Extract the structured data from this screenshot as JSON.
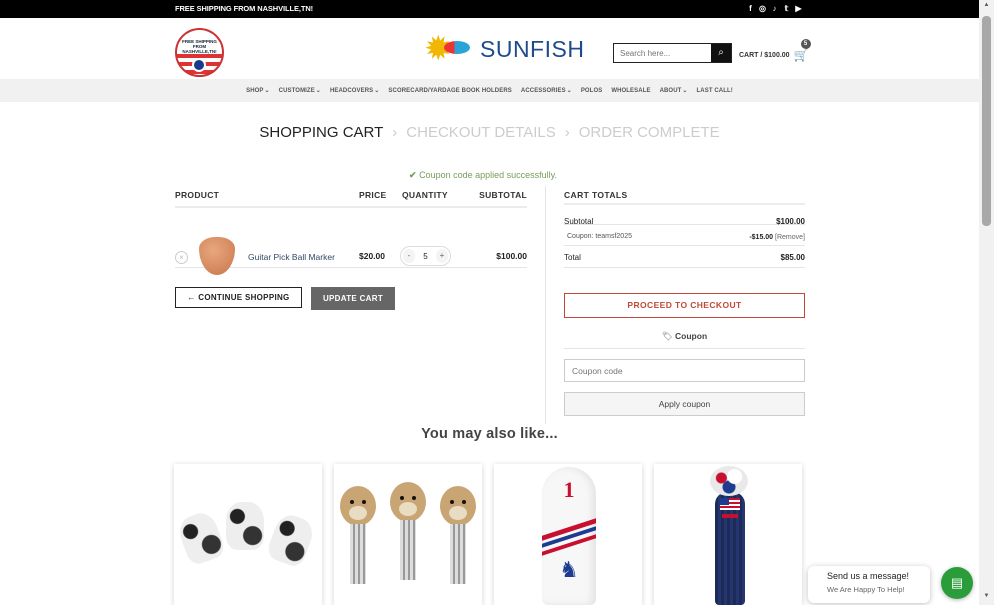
{
  "topbar": {
    "shipping": "FREE SHIPPING FROM NASHVILLE,TN!",
    "social": [
      "f",
      "◎",
      "♪",
      "𝕥",
      "▶"
    ]
  },
  "header": {
    "badge_text": "FREE SHIPPING FROM NASHVILLE,TN!",
    "logo_text": "SUNFISH",
    "search_placeholder": "Search here...",
    "cart_label": "CART / $100.00",
    "cart_count": "5"
  },
  "nav": [
    "SHOP",
    "CUSTOMIZE",
    "HEADCOVERS",
    "SCORECARD/YARDAGE BOOK HOLDERS",
    "ACCESSORIES",
    "POLOS",
    "WHOLESALE",
    "ABOUT",
    "LAST CALL!"
  ],
  "nav_dropdown": [
    true,
    true,
    true,
    false,
    true,
    false,
    false,
    true,
    false
  ],
  "steps": {
    "cart": "SHOPPING CART",
    "checkout": "CHECKOUT DETAILS",
    "complete": "ORDER COMPLETE",
    "sep": "›"
  },
  "coupon_message": "Coupon code applied successfully.",
  "cart_table": {
    "headers": {
      "product": "PRODUCT",
      "price": "PRICE",
      "quantity": "QUANTITY",
      "subtotal": "SUBTOTAL"
    },
    "items": [
      {
        "name": "Guitar Pick Ball Marker",
        "price": "$20.00",
        "qty": "5",
        "subtotal": "$100.00"
      }
    ],
    "continue_label": "← CONTINUE SHOPPING",
    "update_label": "UPDATE CART"
  },
  "totals": {
    "title": "CART TOTALS",
    "subtotal_label": "Subtotal",
    "subtotal_value": "$100.00",
    "coupon_label": "Coupon: teamsf2025",
    "coupon_value": "-$15.00",
    "coupon_remove": "[Remove]",
    "total_label": "Total",
    "total_value": "$85.00",
    "checkout_label": "PROCEED TO CHECKOUT",
    "coupon_heading": "Coupon",
    "coupon_placeholder": "Coupon code",
    "apply_label": "Apply coupon"
  },
  "related": {
    "heading": "You may also like..."
  },
  "chat": {
    "title": "Send us a message!",
    "subtitle": "We Are Happy To Help!"
  },
  "colors": {
    "accent": "#c0483a",
    "success": "#7a9c59",
    "chat": "#2a9d3a"
  }
}
